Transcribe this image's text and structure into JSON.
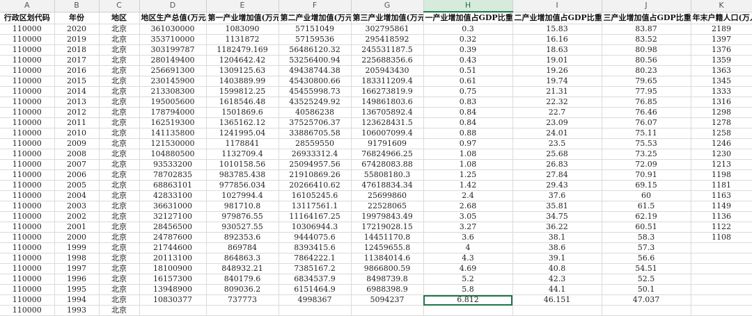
{
  "column_letters": [
    "A",
    "B",
    "C",
    "D",
    "E",
    "F",
    "G",
    "H",
    "I",
    "J",
    "K"
  ],
  "active_column": "H",
  "headers": [
    "行政区划代码",
    "年份",
    "地区",
    "地区生产总值(万元)",
    "第一产业增加值(万元",
    "第二产业增加值(万元",
    "第三产业增加值(万元",
    "一产业增加值占GDP比重(%",
    "二产业增加值占GDP比重(%",
    "三产业增加值占GDP比重(%",
    "年末户籍人口(万人"
  ],
  "rows": [
    [
      "110000",
      "2020",
      "北京",
      "361030000",
      "1083090",
      "57151049",
      "302795861",
      "0.3",
      "15.83",
      "83.87",
      "2189"
    ],
    [
      "110000",
      "2019",
      "北京",
      "353710000",
      "1131872",
      "57159536",
      "295418592",
      "0.32",
      "16.16",
      "83.52",
      "1397"
    ],
    [
      "110000",
      "2018",
      "北京",
      "303199787",
      "1182479.169",
      "56486120.32",
      "245531187.5",
      "0.39",
      "18.63",
      "80.98",
      "1376"
    ],
    [
      "110000",
      "2017",
      "北京",
      "280149400",
      "1204642.42",
      "53256400.94",
      "225688356.6",
      "0.43",
      "19.01",
      "80.56",
      "1359"
    ],
    [
      "110000",
      "2016",
      "北京",
      "256691300",
      "1309125.63",
      "49438744.38",
      "205943430",
      "0.51",
      "19.26",
      "80.23",
      "1363"
    ],
    [
      "110000",
      "2015",
      "北京",
      "230145900",
      "1403889.99",
      "45430800.66",
      "183311209.4",
      "0.61",
      "19.74",
      "79.65",
      "1345"
    ],
    [
      "110000",
      "2014",
      "北京",
      "213308300",
      "1599812.25",
      "45455998.73",
      "166273819.9",
      "0.75",
      "21.31",
      "77.95",
      "1333"
    ],
    [
      "110000",
      "2013",
      "北京",
      "195005600",
      "1618546.48",
      "43525249.92",
      "149861803.6",
      "0.83",
      "22.32",
      "76.85",
      "1316"
    ],
    [
      "110000",
      "2012",
      "北京",
      "178794000",
      "1501869.6",
      "40586238",
      "136705892.4",
      "0.84",
      "22.7",
      "76.46",
      "1298"
    ],
    [
      "110000",
      "2011",
      "北京",
      "162519300",
      "1365162.12",
      "37525706.37",
      "123628431.5",
      "0.84",
      "23.09",
      "76.07",
      "1278"
    ],
    [
      "110000",
      "2010",
      "北京",
      "141135800",
      "1241995.04",
      "33886705.58",
      "106007099.4",
      "0.88",
      "24.01",
      "75.11",
      "1258"
    ],
    [
      "110000",
      "2009",
      "北京",
      "121530000",
      "1178841",
      "28559550",
      "91791609",
      "0.97",
      "23.5",
      "75.53",
      "1246"
    ],
    [
      "110000",
      "2008",
      "北京",
      "104880500",
      "1132709.4",
      "26933312.4",
      "76824966.25",
      "1.08",
      "25.68",
      "73.25",
      "1230"
    ],
    [
      "110000",
      "2007",
      "北京",
      "93533200",
      "1010158.56",
      "25094957.56",
      "67428083.88",
      "1.08",
      "26.83",
      "72.09",
      "1213"
    ],
    [
      "110000",
      "2006",
      "北京",
      "78702835",
      "983785.438",
      "21910869.26",
      "55808180.3",
      "1.25",
      "27.84",
      "70.91",
      "1198"
    ],
    [
      "110000",
      "2005",
      "北京",
      "68863101",
      "977856.034",
      "20266410.62",
      "47618834.34",
      "1.42",
      "29.43",
      "69.15",
      "1181"
    ],
    [
      "110000",
      "2004",
      "北京",
      "42833100",
      "1027994.4",
      "16105245.6",
      "25699860",
      "2.4",
      "37.6",
      "60",
      "1163"
    ],
    [
      "110000",
      "2003",
      "北京",
      "36631000",
      "981710.8",
      "13117561.1",
      "22528065",
      "2.68",
      "35.81",
      "61.5",
      "1149"
    ],
    [
      "110000",
      "2002",
      "北京",
      "32127100",
      "979876.55",
      "11164167.25",
      "19979843.49",
      "3.05",
      "34.75",
      "62.19",
      "1136"
    ],
    [
      "110000",
      "2001",
      "北京",
      "28456500",
      "930527.55",
      "10306944.3",
      "17219028.15",
      "3.27",
      "36.22",
      "60.51",
      "1122"
    ],
    [
      "110000",
      "2000",
      "北京",
      "24787600",
      "892353.6",
      "9444075.6",
      "14451170.8",
      "3.6",
      "38.1",
      "58.3",
      "1108"
    ],
    [
      "110000",
      "1999",
      "北京",
      "21744600",
      "869784",
      "8393415.6",
      "12459655.8",
      "4",
      "38.6",
      "57.3",
      ""
    ],
    [
      "110000",
      "1998",
      "北京",
      "20113100",
      "864863.3",
      "7864222.1",
      "11384014.6",
      "4.3",
      "39.1",
      "56.6",
      ""
    ],
    [
      "110000",
      "1997",
      "北京",
      "18100900",
      "848932.21",
      "7385167.2",
      "9866800.59",
      "4.69",
      "40.8",
      "54.51",
      ""
    ],
    [
      "110000",
      "1996",
      "北京",
      "16157300",
      "840179.6",
      "6834537.9",
      "8498739.8",
      "5.2",
      "42.3",
      "52.5",
      ""
    ],
    [
      "110000",
      "1995",
      "北京",
      "13948900",
      "809036.2",
      "6151464.9",
      "6988398.9",
      "5.8",
      "44.1",
      "50.1",
      ""
    ],
    [
      "110000",
      "1994",
      "北京",
      "10830377",
      "737773",
      "4998367",
      "5094237",
      "6.812",
      "46.151",
      "47.037",
      ""
    ],
    [
      "110000",
      "1993",
      "北京",
      "",
      "",
      "",
      "",
      "",
      "",
      "",
      ""
    ]
  ]
}
